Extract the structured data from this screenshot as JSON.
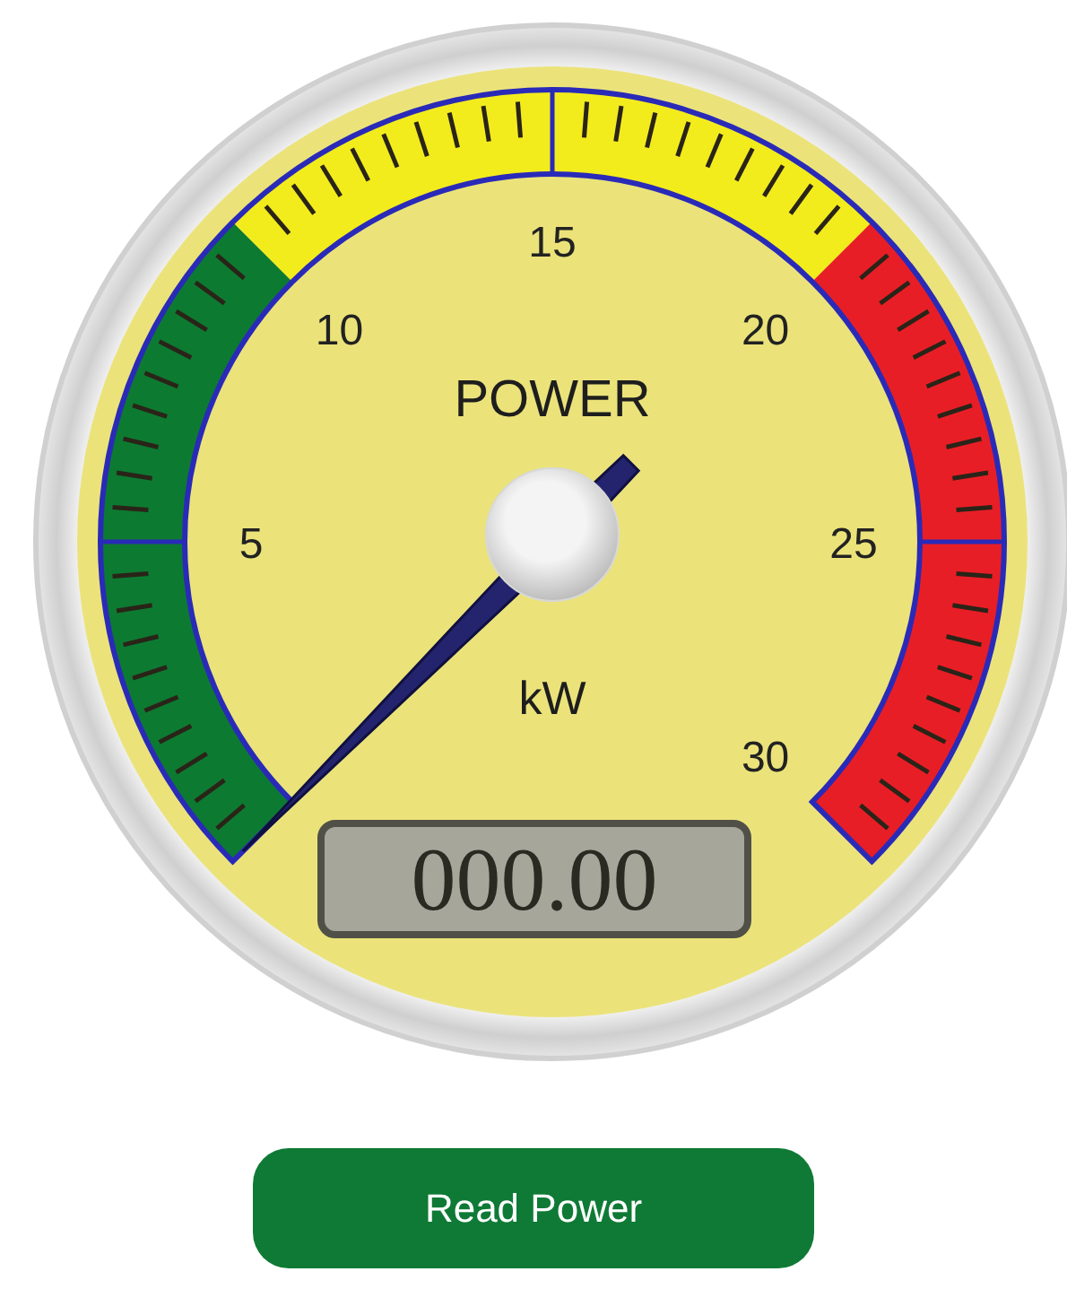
{
  "gauge": {
    "title": "POWER",
    "unit": "kW",
    "reading": "000.00",
    "scale_labels": [
      "5",
      "10",
      "15",
      "20",
      "25",
      "30"
    ],
    "zones": [
      {
        "color": "#0d7a32"
      },
      {
        "color": "#f3ec1c"
      },
      {
        "color": "#e81e26"
      }
    ]
  },
  "button": "Read Power"
}
